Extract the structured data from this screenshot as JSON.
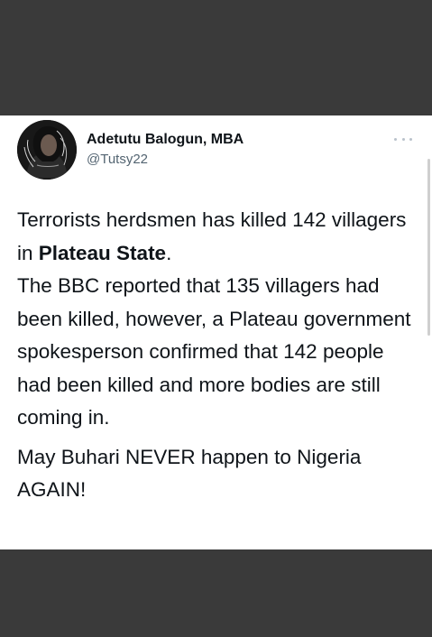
{
  "author": {
    "name": "Adetutu Balogun, MBA",
    "handle": "@Tutsy22",
    "avatar_icon": "profile-photo",
    "more_icon": "more-options-icon"
  },
  "tweet": {
    "paragraph1_a": "Terrorists herdsmen has killed 142 villagers in ",
    "paragraph1_bold": "Plateau State",
    "paragraph1_b": ".",
    "paragraph1_line2": "The BBC reported that 135 villagers had been killed, however, a Plateau government spokesperson confirmed that 142 people had been killed and more bodies are still coming in.",
    "paragraph2": "May Buhari NEVER happen to Nigeria AGAIN!"
  },
  "colors": {
    "background_dark": "#3a3a3a",
    "card": "#ffffff",
    "text": "#0f1419",
    "muted": "#536471"
  }
}
